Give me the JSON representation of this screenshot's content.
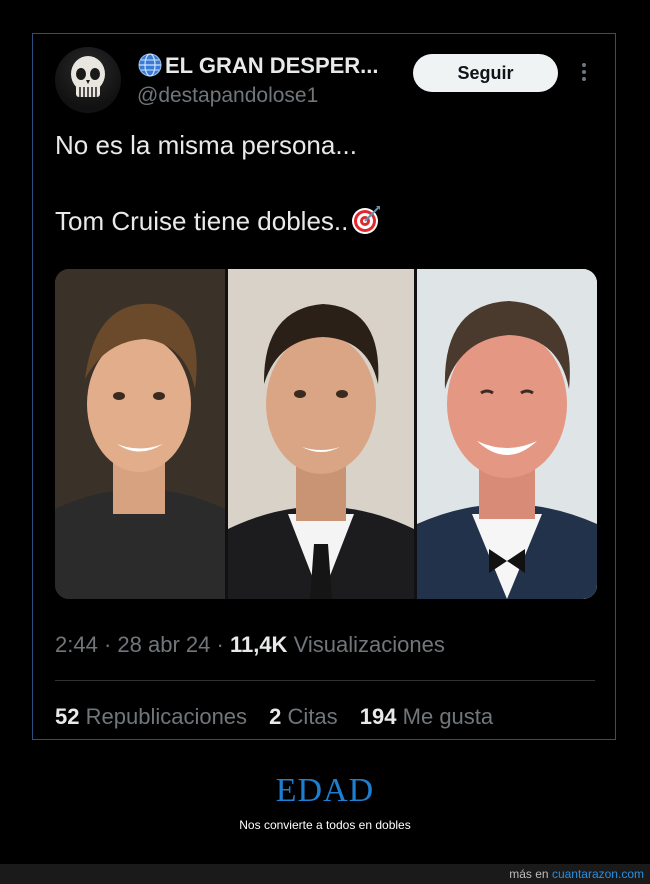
{
  "tweet": {
    "display_name": "EL GRAN DESPER...",
    "handle": "@destapandolose1",
    "follow_label": "Seguir",
    "text_line1": "No es la misma persona...",
    "text_line2": "Tom Cruise tiene dobles..",
    "icons": {
      "verified": "globe-icon",
      "emoji": "target-emoji-icon",
      "more": "more-options-icon"
    },
    "media": {
      "images": [
        "photo-1",
        "photo-2",
        "photo-3"
      ]
    },
    "time": "2:44",
    "date": "28 abr 24",
    "views_count": "11,4K",
    "views_label": "Visualizaciones",
    "stats": {
      "reposts_count": "52",
      "reposts_label": "Republicaciones",
      "quotes_count": "2",
      "quotes_label": "Citas",
      "likes_count": "194",
      "likes_label": "Me gusta"
    }
  },
  "caption": {
    "title": "EDAD",
    "subtitle": "Nos convierte a todos en dobles"
  },
  "footer": {
    "prefix": "más en",
    "site": "cuantarazon.com"
  },
  "colors": {
    "background": "#000000",
    "border": "#2d4f7d",
    "caption_title": "#1e7fd1",
    "link": "#2a8fe0",
    "muted": "#71767b"
  }
}
